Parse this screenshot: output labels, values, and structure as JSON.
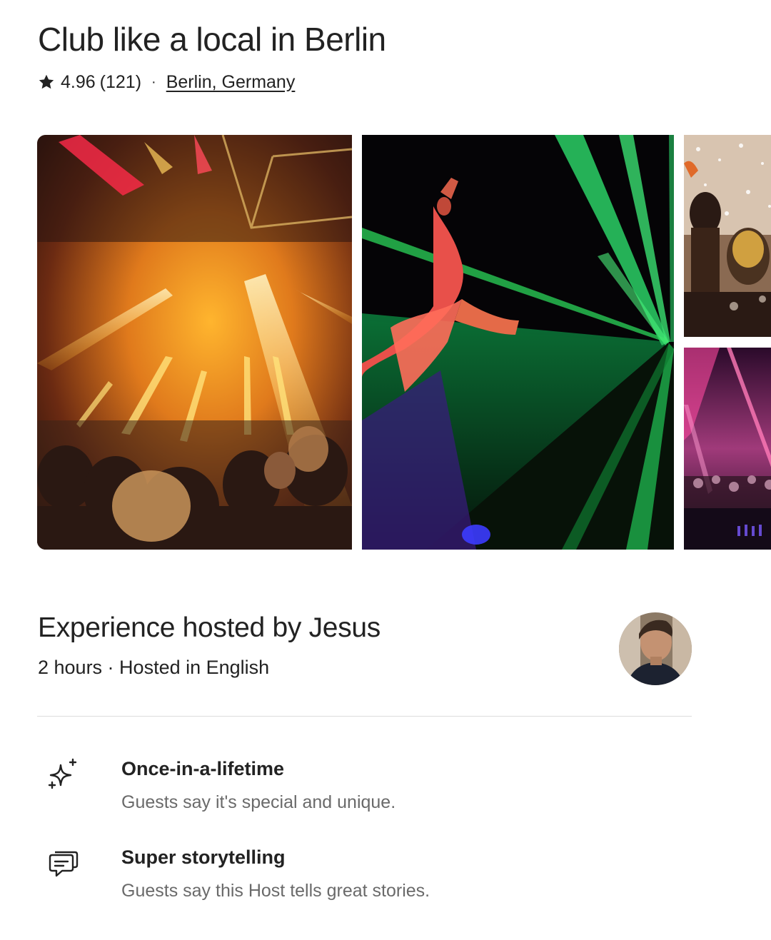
{
  "listing": {
    "title": "Club like a local in Berlin",
    "rating": "4.96",
    "reviews": "(121)",
    "separator": "·",
    "location": "Berlin, Germany"
  },
  "gallery": {
    "photos": [
      {
        "description": "club-crowd-yellow-lights"
      },
      {
        "description": "dancer-green-lasers"
      },
      {
        "description": "crowd-confetti"
      },
      {
        "description": "pink-laser-dancefloor"
      }
    ]
  },
  "host": {
    "heading": "Experience hosted by Jesus",
    "details": "2 hours · Hosted in English"
  },
  "highlights": [
    {
      "icon": "sparkles-icon",
      "title": "Once-in-a-lifetime",
      "description": "Guests say it's special and unique."
    },
    {
      "icon": "chat-bubbles-icon",
      "title": "Super storytelling",
      "description": "Guests say this Host tells great stories."
    }
  ],
  "colors": {
    "text": "#222222",
    "secondary_text": "#6a6a6a",
    "divider": "#dddddd"
  }
}
